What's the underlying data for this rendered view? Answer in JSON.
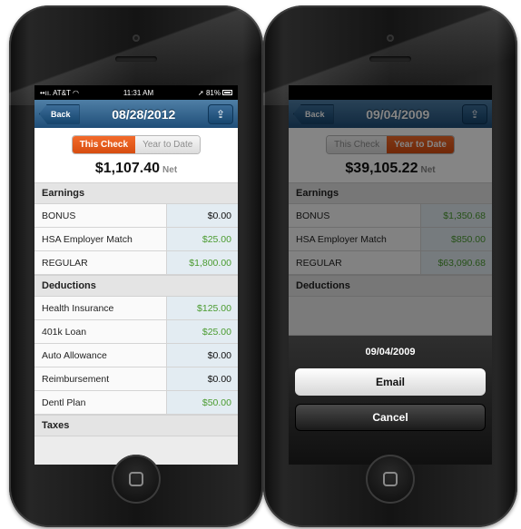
{
  "left": {
    "status": {
      "carrier": "AT&T",
      "time": "11:31 AM",
      "battery": "81%"
    },
    "nav": {
      "back": "Back",
      "title": "08/28/2012",
      "share_icon": "share-icon"
    },
    "segments": {
      "active": "This Check",
      "inactive": "Year to Date"
    },
    "net": {
      "amount": "$1,107.40",
      "label": "Net"
    },
    "earnings": {
      "title": "Earnings",
      "rows": [
        {
          "name": "BONUS",
          "value": "$0.00"
        },
        {
          "name": "HSA Employer Match",
          "value": "$25.00"
        },
        {
          "name": "REGULAR",
          "value": "$1,800.00"
        }
      ]
    },
    "deductions": {
      "title": "Deductions",
      "rows": [
        {
          "name": "Health Insurance",
          "value": "$125.00"
        },
        {
          "name": "401k Loan",
          "value": "$25.00"
        },
        {
          "name": "Auto Allowance",
          "value": "$0.00"
        },
        {
          "name": "Reimbursement",
          "value": "$0.00"
        },
        {
          "name": "Dentl Plan",
          "value": "$50.00"
        }
      ]
    },
    "taxes_title": "Taxes"
  },
  "right": {
    "nav": {
      "back": "Back",
      "title": "09/04/2009",
      "share_icon": "share-icon"
    },
    "segments": {
      "inactive": "This Check",
      "active": "Year to Date"
    },
    "net": {
      "amount": "$39,105.22",
      "label": "Net"
    },
    "earnings": {
      "title": "Earnings",
      "rows": [
        {
          "name": "BONUS",
          "value": "$1,350.68"
        },
        {
          "name": "HSA Employer Match",
          "value": "$850.00"
        },
        {
          "name": "REGULAR",
          "value": "$63,090.68"
        }
      ]
    },
    "deductions_title": "Deductions",
    "sheet": {
      "title": "09/04/2009",
      "email": "Email",
      "cancel": "Cancel"
    }
  },
  "colors": {
    "accent_orange": "#e85a1c",
    "nav_blue": "#2a5c87",
    "green_value": "#4a9b2f"
  }
}
